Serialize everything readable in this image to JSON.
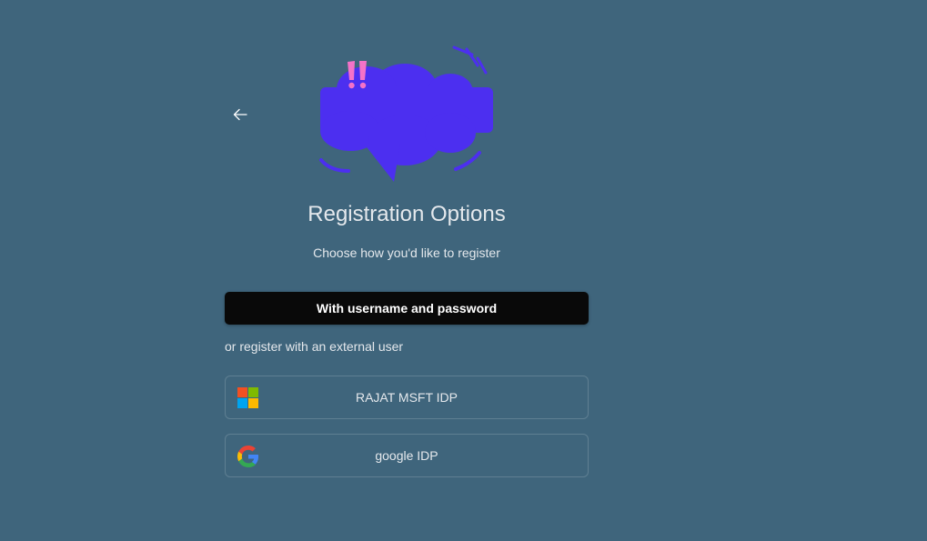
{
  "header": {
    "back_icon": "arrow-left-icon",
    "illustration": "speech-bubble-exclamation-illustration"
  },
  "main": {
    "title": "Registration Options",
    "subtitle": "Choose how you'd like to register",
    "primary_button_label": "With username and password",
    "external_label": "or register with an external user",
    "providers": [
      {
        "label": "RAJAT MSFT IDP",
        "icon": "microsoft-logo-icon"
      },
      {
        "label": "google IDP",
        "icon": "google-logo-icon"
      }
    ]
  },
  "colors": {
    "background": "#3f657c",
    "primary_button": "#090909",
    "illustration": "#4c2ff0",
    "accent_pink": "#f472c8"
  }
}
